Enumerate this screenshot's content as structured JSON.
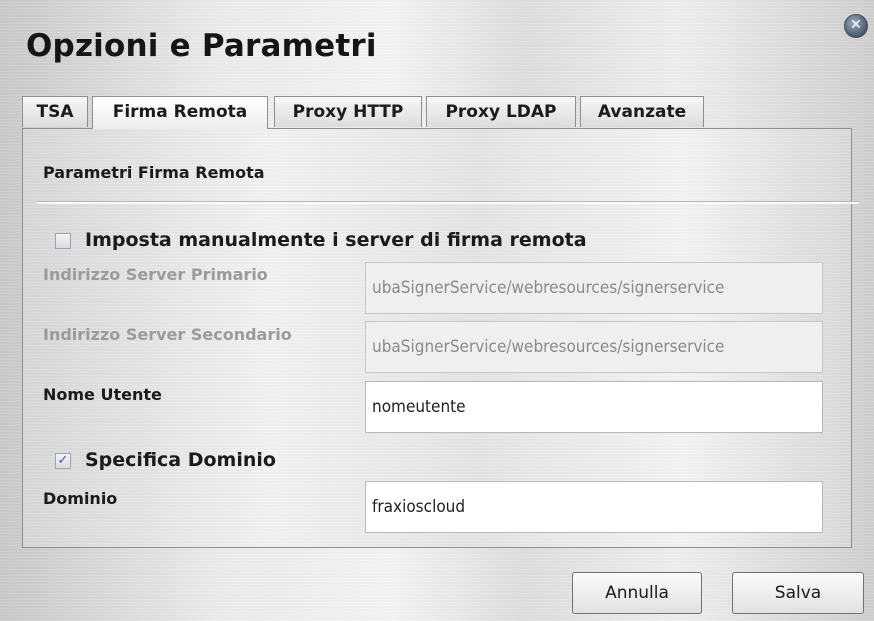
{
  "window": {
    "title": "Opzioni e Parametri",
    "close_glyph": "✕"
  },
  "tabs": [
    {
      "label": "TSA",
      "active": false
    },
    {
      "label": "Firma Remota",
      "active": true
    },
    {
      "label": "Proxy HTTP",
      "active": false
    },
    {
      "label": "Proxy LDAP",
      "active": false
    },
    {
      "label": "Avanzate",
      "active": false
    }
  ],
  "panel": {
    "section_title": "Parametri Firma Remota",
    "manual_servers": {
      "label": "Imposta manualmente i server di firma remota",
      "checked": false
    },
    "primary_server": {
      "label": "Indirizzo Server Primario",
      "value": "ubaSignerService/webresources/signerservice",
      "disabled": true
    },
    "secondary_server": {
      "label": "Indirizzo Server Secondario",
      "value": "ubaSignerService/webresources/signerservice",
      "disabled": true
    },
    "username": {
      "label": "Nome Utente",
      "value": "nomeutente"
    },
    "specify_domain": {
      "label": "Specifica Dominio",
      "checked": true,
      "check_glyph": "✓"
    },
    "domain": {
      "label": "Dominio",
      "value": "fraxioscloud"
    }
  },
  "buttons": {
    "cancel": "Annulla",
    "save": "Salva"
  }
}
